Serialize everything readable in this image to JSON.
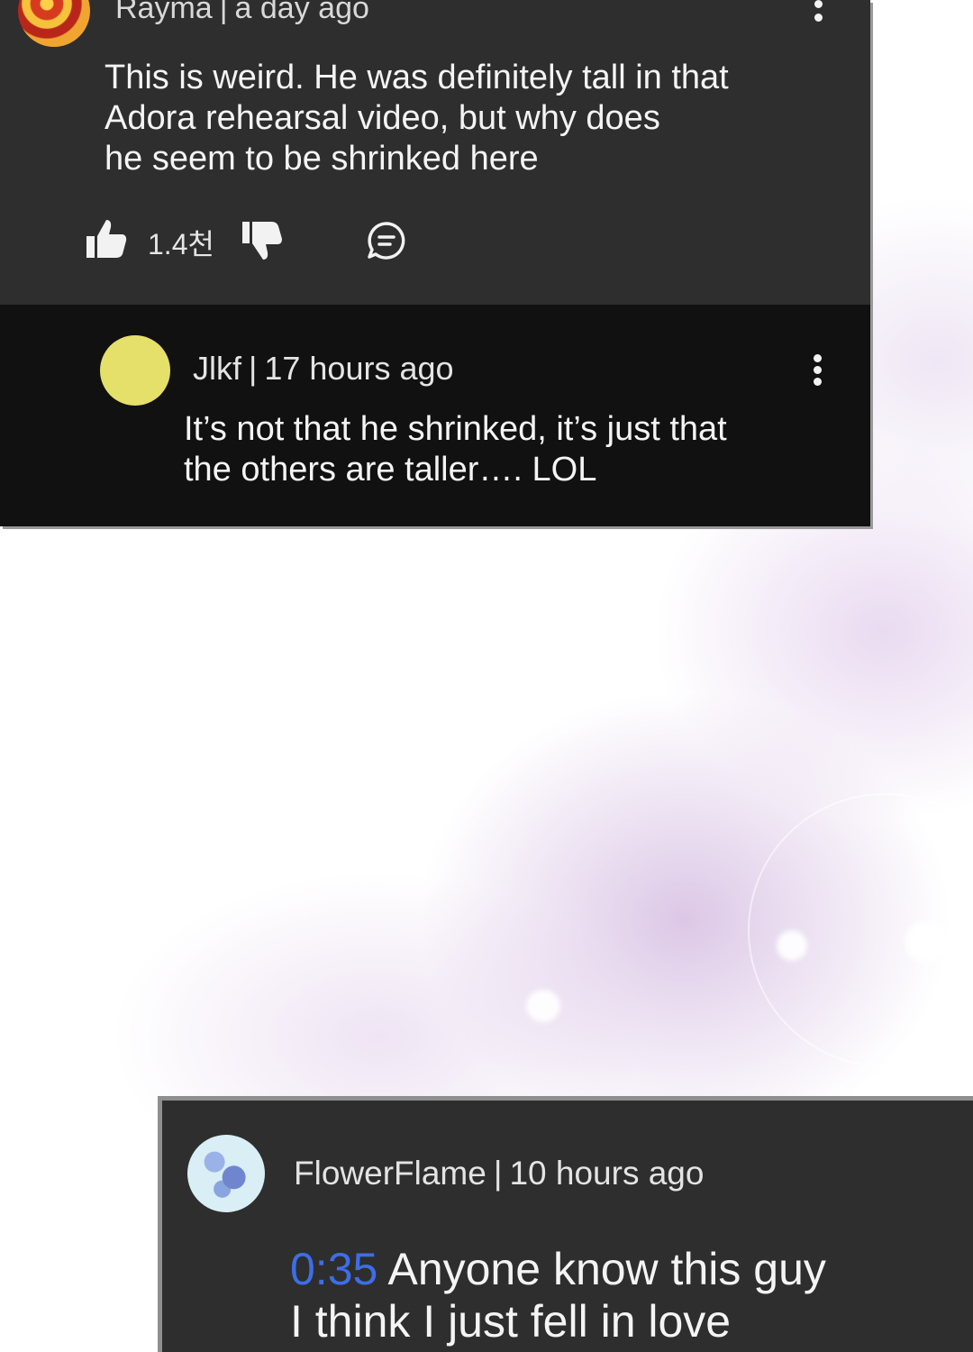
{
  "comments": [
    {
      "author": "Rayma",
      "time": "a day ago",
      "lines": [
        "This is weird. He was definitely tall in that",
        "Adora rehearsal video, but why does",
        "he seem to be shrinked here"
      ],
      "likes": "1.4천",
      "reply": {
        "author": "Jlkf",
        "time": "17 hours ago",
        "lines": [
          "It’s not that he shrinked, it’s just that",
          "the others are taller…. LOL"
        ]
      }
    },
    {
      "author": "FlowerFlame",
      "time": "10 hours ago",
      "timestamp_link": "0:35",
      "lines": [
        "Anyone know this guy",
        "I think I just fell in love"
      ]
    }
  ],
  "separator": "|",
  "colors": {
    "card_bg": "#2e2e2e",
    "reply_bg": "#111111",
    "link": "#3d6ee8",
    "jlkf_avatar": "#e4e06a"
  },
  "icons": [
    "like-icon",
    "dislike-icon",
    "reply-icon",
    "more-options-icon"
  ]
}
